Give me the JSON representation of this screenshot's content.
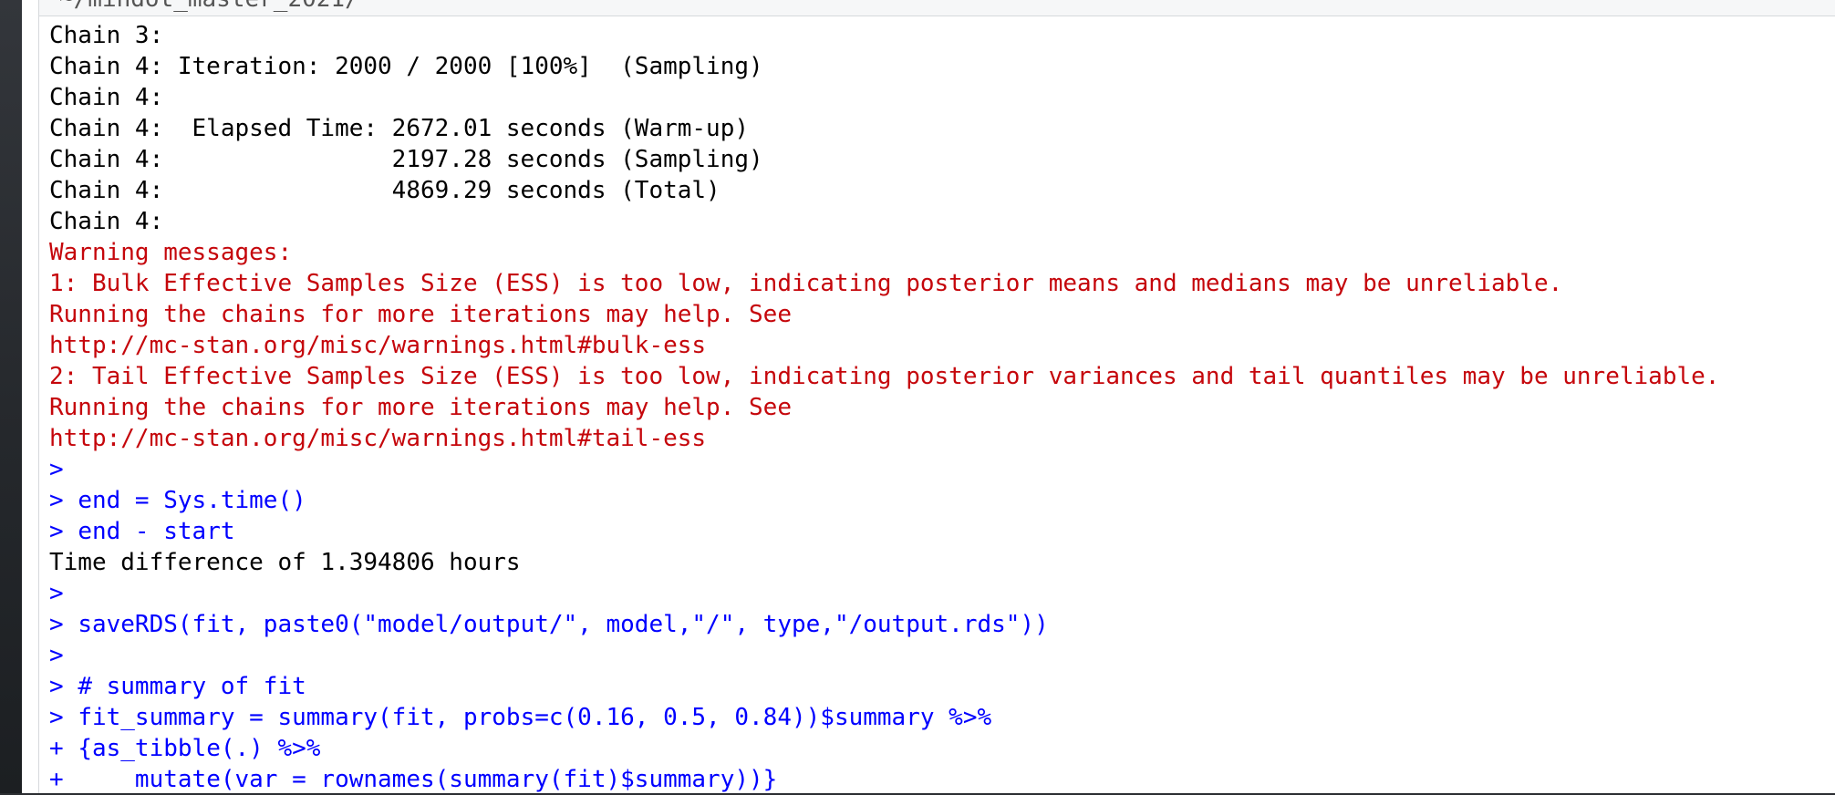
{
  "console": {
    "path": "~/mindot_master_2021/",
    "path_arrow_icon": "goto-directory-arrow-icon",
    "colors": {
      "output": "#000000",
      "error": "#c5060b",
      "input": "#0000ff"
    },
    "lines": [
      {
        "kind": "out",
        "text": "Chain 3: "
      },
      {
        "kind": "out",
        "text": "Chain 4: Iteration: 2000 / 2000 [100%]  (Sampling)"
      },
      {
        "kind": "out",
        "text": "Chain 4: "
      },
      {
        "kind": "out",
        "text": "Chain 4:  Elapsed Time: 2672.01 seconds (Warm-up)"
      },
      {
        "kind": "out",
        "text": "Chain 4:                2197.28 seconds (Sampling)"
      },
      {
        "kind": "out",
        "text": "Chain 4:                4869.29 seconds (Total)"
      },
      {
        "kind": "out",
        "text": "Chain 4: "
      },
      {
        "kind": "err",
        "text": "Warning messages:"
      },
      {
        "kind": "err",
        "text": "1: Bulk Effective Samples Size (ESS) is too low, indicating posterior means and medians may be unreliable."
      },
      {
        "kind": "err",
        "text": "Running the chains for more iterations may help. See"
      },
      {
        "kind": "err",
        "text": "http://mc-stan.org/misc/warnings.html#bulk-ess "
      },
      {
        "kind": "err",
        "text": "2: Tail Effective Samples Size (ESS) is too low, indicating posterior variances and tail quantiles may be unreliable."
      },
      {
        "kind": "err",
        "text": "Running the chains for more iterations may help. See"
      },
      {
        "kind": "err",
        "text": "http://mc-stan.org/misc/warnings.html#tail-ess "
      },
      {
        "kind": "in",
        "prompt": ">",
        "text": ""
      },
      {
        "kind": "in",
        "prompt": "> ",
        "text": "end = Sys.time()"
      },
      {
        "kind": "in",
        "prompt": "> ",
        "text": "end - start"
      },
      {
        "kind": "out",
        "text": "Time difference of 1.394806 hours"
      },
      {
        "kind": "in",
        "prompt": ">",
        "text": ""
      },
      {
        "kind": "in",
        "prompt": "> ",
        "text": "saveRDS(fit, paste0(\"model/output/\", model,\"/\", type,\"/output.rds\"))"
      },
      {
        "kind": "in",
        "prompt": ">",
        "text": ""
      },
      {
        "kind": "in",
        "prompt": "> ",
        "text": "# summary of fit"
      },
      {
        "kind": "in",
        "prompt": "> ",
        "text": "fit_summary = summary(fit, probs=c(0.16, 0.5, 0.84))$summary %>%"
      },
      {
        "kind": "in",
        "prompt": "+ ",
        "text": "{as_tibble(.) %>%"
      },
      {
        "kind": "in",
        "prompt": "+ ",
        "text": "    mutate(var = rownames(summary(fit)$summary))}"
      }
    ]
  }
}
